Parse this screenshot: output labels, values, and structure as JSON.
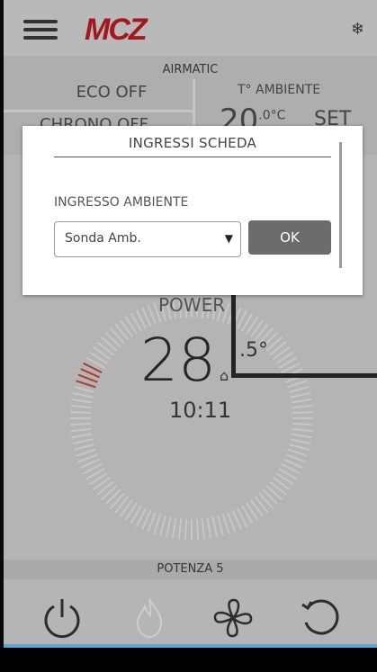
{
  "header": {
    "logo": "MCZ",
    "menu_icon": "hamburger-icon",
    "snow_icon": "❄"
  },
  "info": {
    "airmatic": "AIRMATIC",
    "eco": "ECO OFF",
    "crono": "CHRONO OFF",
    "t_ambiente_label": "T° AMBIENTE",
    "t_ambiente_value": "20",
    "t_ambiente_unit": ".0°C",
    "set": "SET"
  },
  "main": {
    "power": "POWER",
    "temp_int": "28",
    "temp_dec": ".5°",
    "home_icon": "⌂",
    "time": "10:11"
  },
  "potenza": "POTENZA 5",
  "bottom": {
    "icons": [
      "power-icon",
      "flame-icon",
      "fan-icon",
      "refresh-icon"
    ]
  },
  "dialog": {
    "title": "INGRESSI SCHEDA",
    "field_label": "INGRESSO AMBIENTE",
    "select_value": "Sonda Amb.",
    "arrow": "▼",
    "ok_label": "OK"
  },
  "colors": {
    "brand": "#b01218",
    "ok_button": "#6c6c6c",
    "dial_red": "#c0392b"
  }
}
